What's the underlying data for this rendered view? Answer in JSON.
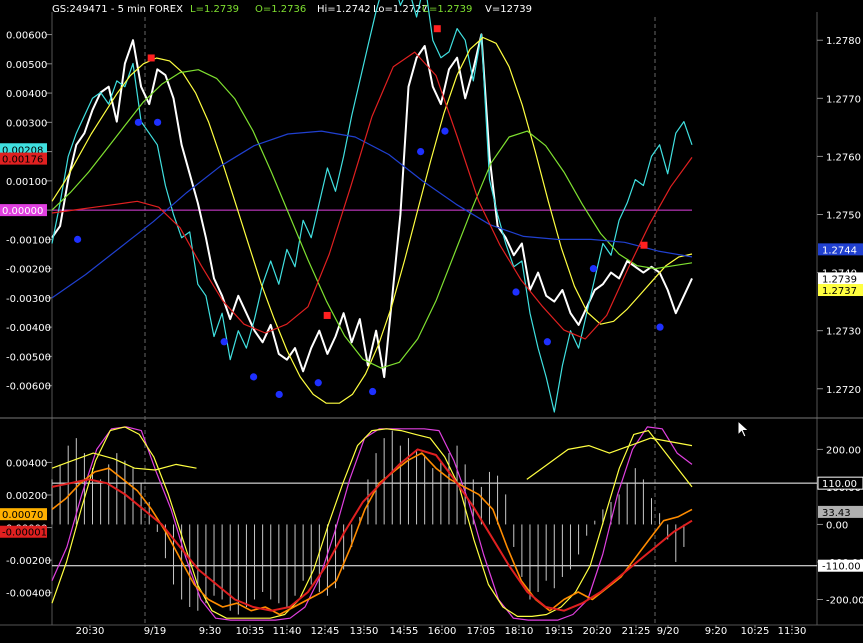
{
  "header": {
    "symbol": "GS:249471 - 5 min  FOREX",
    "last": "L=1.2739",
    "open": "O=1.2736",
    "high": "Hi=1.2742",
    "low": "Lo=1.2727",
    "close": "C=1.2739",
    "volume": "V=12739"
  },
  "colors": {
    "background": "#000000",
    "grid": "#3a3a3a",
    "price": "#ffffff",
    "cyan": "#40e0e0",
    "yellow": "#ffff40",
    "green": "#7fe030",
    "red": "#e02020",
    "blue": "#2040d0",
    "magenta": "#e040e0",
    "orange": "#ff8c00",
    "histogram": "#c8c8c8",
    "accent_dots_blue": "#1e30ff",
    "accent_dots_red": "#ff2020"
  },
  "chart_data": [
    {
      "type": "line",
      "name": "price-panel",
      "left_axis": {
        "ticks": [
          "0.00600",
          "0.00500",
          "0.00400",
          "0.00300",
          "0.00200",
          "0.00100",
          "0.00000",
          "-0.00100",
          "-0.00200",
          "-0.00300",
          "-0.00400",
          "-0.00500",
          "-0.00600"
        ],
        "range": [
          -0.0069,
          0.0066
        ]
      },
      "right_axis": {
        "ticks": [
          "1.2780",
          "1.2770",
          "1.2760",
          "1.2750",
          "1.2740",
          "1.2730",
          "1.2720"
        ],
        "range": [
          1.2716,
          1.2784
        ]
      },
      "left_badges": [
        {
          "text": "0.00208",
          "value": 0.00208,
          "color": "#40e0e0",
          "text_color": "#000000"
        },
        {
          "text": "0.00176",
          "value": 0.00176,
          "color": "#e02020",
          "text_color": "#000000"
        },
        {
          "text": "0.00000",
          "value": 0.0,
          "color": "#e040e0",
          "text_color": "#ffffff"
        }
      ],
      "right_badges": [
        {
          "text": "1.2744",
          "value": 1.2744,
          "color": "#2040d0",
          "text_color": "#ffffff"
        },
        {
          "text": "1.2740",
          "value": 1.274,
          "color": "#000000",
          "text_color": "#ffffff"
        },
        {
          "text": "1.2739",
          "value": 1.2739,
          "color": "#ffffff",
          "text_color": "#000000"
        },
        {
          "text": "1.2737",
          "value": 1.2737,
          "color": "#ffff40",
          "text_color": "#000000"
        }
      ],
      "reference_line": {
        "value": 0.0,
        "color": "#e040e0"
      },
      "series": [
        {
          "id": "price",
          "color": "#ffffff",
          "width": 2,
          "axis": "right",
          "values": [
            1.2746,
            1.2748,
            1.2756,
            1.2762,
            1.2764,
            1.2768,
            1.2771,
            1.2772,
            1.2766,
            1.2776,
            1.278,
            1.2772,
            1.2769,
            1.2775,
            1.2774,
            1.277,
            1.2762,
            1.2757,
            1.2752,
            1.2746,
            1.2739,
            1.2736,
            1.2732,
            1.2736,
            1.2733,
            1.273,
            1.2728,
            1.2731,
            1.2726,
            1.2725,
            1.2727,
            1.2723,
            1.2727,
            1.273,
            1.2726,
            1.2729,
            1.2733,
            1.2728,
            1.2732,
            1.2724,
            1.273,
            1.2722,
            1.2736,
            1.275,
            1.2772,
            1.2777,
            1.2779,
            1.2772,
            1.2769,
            1.2775,
            1.2777,
            1.277,
            1.2775,
            1.2781,
            1.276,
            1.2748,
            1.2746,
            1.2743,
            1.2745,
            1.2737,
            1.274,
            1.2736,
            1.2735,
            1.2737,
            1.2733,
            1.2731,
            1.2734,
            1.2737,
            1.2738,
            1.274,
            1.2739,
            1.2742,
            1.2741,
            1.274,
            1.2741,
            1.274,
            1.2737,
            1.2733,
            1.2736,
            1.2739
          ]
        },
        {
          "id": "cyan-line",
          "color": "#40e0e0",
          "width": 1.2,
          "axis": "right",
          "values": [
            1.2745,
            1.2752,
            1.276,
            1.2764,
            1.2767,
            1.277,
            1.2771,
            1.2769,
            1.2773,
            1.2772,
            1.2776,
            1.2766,
            1.2764,
            1.2762,
            1.2755,
            1.275,
            1.2746,
            1.2747,
            1.2738,
            1.2736,
            1.2729,
            1.2733,
            1.2725,
            1.273,
            1.2727,
            1.2732,
            1.2738,
            1.2742,
            1.2738,
            1.2744,
            1.2741,
            1.2749,
            1.2746,
            1.2752,
            1.2758,
            1.2754,
            1.276,
            1.2767,
            1.2773,
            1.2779,
            1.2785,
            1.279,
            1.2791,
            1.2786,
            1.2789,
            1.2784,
            1.279,
            1.278,
            1.2777,
            1.2778,
            1.2782,
            1.278,
            1.2773,
            1.2781,
            1.2756,
            1.275,
            1.2745,
            1.2741,
            1.2742,
            1.2733,
            1.2727,
            1.2722,
            1.2716,
            1.2724,
            1.273,
            1.2727,
            1.2733,
            1.2739,
            1.2745,
            1.2743,
            1.2749,
            1.2752,
            1.2756,
            1.2755,
            1.276,
            1.2762,
            1.2757,
            1.2764,
            1.2766,
            1.2762
          ]
        },
        {
          "id": "yellow-line",
          "color": "#ffff40",
          "width": 1.2,
          "axis": "left",
          "values": [
            0.0003,
            0.001,
            0.0018,
            0.0026,
            0.0033,
            0.004,
            0.0046,
            0.005,
            0.0052,
            0.0051,
            0.0047,
            0.004,
            0.003,
            0.0017,
            0.0003,
            -0.0011,
            -0.0025,
            -0.0037,
            -0.0048,
            -0.0057,
            -0.0063,
            -0.0066,
            -0.0066,
            -0.0063,
            -0.0056,
            -0.0046,
            -0.0033,
            -0.0017,
            0.0,
            0.0017,
            0.0033,
            0.0046,
            0.0055,
            0.0059,
            0.0057,
            0.0049,
            0.0036,
            0.002,
            0.0003,
            -0.0013,
            -0.0026,
            -0.0035,
            -0.0039,
            -0.0038,
            -0.0034,
            -0.0029,
            -0.0024,
            -0.0019,
            -0.0016,
            -0.0015
          ]
        },
        {
          "id": "green-line",
          "color": "#7fe030",
          "width": 1.2,
          "axis": "left",
          "values": [
            0.0,
            0.0006,
            0.0013,
            0.0021,
            0.0029,
            0.0037,
            0.0043,
            0.0047,
            0.0048,
            0.0045,
            0.0038,
            0.0027,
            0.0013,
            -0.0002,
            -0.0017,
            -0.0031,
            -0.0043,
            -0.0051,
            -0.0054,
            -0.0052,
            -0.0044,
            -0.0031,
            -0.0015,
            0.0001,
            0.0016,
            0.0025,
            0.0027,
            0.0022,
            0.0013,
            0.0002,
            -0.0008,
            -0.0015,
            -0.0019,
            -0.002,
            -0.0019,
            -0.0018
          ]
        },
        {
          "id": "blue-line",
          "color": "#2040d0",
          "width": 1.2,
          "axis": "left",
          "values": [
            -0.003,
            -0.0022,
            -0.0013,
            -0.0004,
            0.0006,
            0.0015,
            0.0022,
            0.0026,
            0.0027,
            0.0025,
            0.0019,
            0.001,
            0.0002,
            -0.0005,
            -0.0009,
            -0.001,
            -0.001,
            -0.0011,
            -0.0014,
            -0.0016
          ]
        },
        {
          "id": "red-line",
          "color": "#e02020",
          "width": 1.2,
          "axis": "left",
          "values": [
            -0.0001,
            0.0,
            0.0001,
            0.0002,
            0.0003,
            0.0001,
            -0.0006,
            -0.0019,
            -0.0031,
            -0.0039,
            -0.0042,
            -0.0039,
            -0.0033,
            -0.0015,
            0.0008,
            0.0032,
            0.0049,
            0.0054,
            0.0046,
            0.0025,
            0.0003,
            -0.0012,
            -0.0024,
            -0.0033,
            -0.0041,
            -0.0044,
            -0.0036,
            -0.002,
            -0.0005,
            0.0008,
            0.0018
          ]
        }
      ],
      "dots": [
        {
          "x": 0.04,
          "value": -0.001,
          "color": "#1e30ff"
        },
        {
          "x": 0.135,
          "value": 0.003,
          "color": "#1e30ff"
        },
        {
          "x": 0.165,
          "value": 0.003,
          "color": "#1e30ff"
        },
        {
          "x": 0.155,
          "value": 0.0052,
          "color": "#ff2020"
        },
        {
          "x": 0.269,
          "value": -0.0045,
          "color": "#1e30ff"
        },
        {
          "x": 0.315,
          "value": -0.0057,
          "color": "#1e30ff"
        },
        {
          "x": 0.355,
          "value": -0.0063,
          "color": "#1e30ff"
        },
        {
          "x": 0.416,
          "value": -0.0059,
          "color": "#1e30ff"
        },
        {
          "x": 0.43,
          "value": -0.0036,
          "color": "#ff2020"
        },
        {
          "x": 0.501,
          "value": -0.0062,
          "color": "#1e30ff"
        },
        {
          "x": 0.576,
          "value": 0.002,
          "color": "#1e30ff"
        },
        {
          "x": 0.614,
          "value": 0.0027,
          "color": "#1e30ff"
        },
        {
          "x": 0.602,
          "value": 0.0062,
          "color": "#ff2020"
        },
        {
          "x": 0.725,
          "value": -0.0028,
          "color": "#1e30ff"
        },
        {
          "x": 0.774,
          "value": -0.0045,
          "color": "#1e30ff"
        },
        {
          "x": 0.846,
          "value": -0.002,
          "color": "#1e30ff"
        },
        {
          "x": 0.925,
          "value": -0.0012,
          "color": "#ff2020"
        },
        {
          "x": 0.95,
          "value": -0.004,
          "color": "#1e30ff"
        }
      ]
    },
    {
      "type": "line",
      "name": "oscillator-panel",
      "left_axis": {
        "ticks": [
          "0.00400",
          "0.00200",
          "0.00000",
          "-0.00200",
          "-0.00400"
        ],
        "range": [
          -0.0058,
          0.0063
        ]
      },
      "right_axis": {
        "ticks": [
          "200.00",
          "100.00",
          "0.00",
          "-100.00",
          "-200.00"
        ],
        "range": [
          -260,
          265
        ]
      },
      "hlines": [
        110,
        -110
      ],
      "left_badges": [
        {
          "text": "0.00070",
          "value": 0.0007,
          "color": "#ffb000",
          "text_color": "#000000"
        },
        {
          "text": "-0.00001",
          "value": -1e-05,
          "color": "#e02020",
          "text_color": "#000000"
        }
      ],
      "right_badges": [
        {
          "text": "110.00",
          "value": 110,
          "color": "#000000",
          "text_color": "#ffffff",
          "border": "#ffffff"
        },
        {
          "text": "33.43",
          "value": 33.43,
          "color": "#b0b0b0",
          "text_color": "#000000"
        },
        {
          "text": "-110.00",
          "value": -110,
          "color": "#ffffff",
          "text_color": "#000000"
        }
      ],
      "series": [
        {
          "id": "hist",
          "color": "#c8c8c8",
          "kind": "histogram",
          "values": [
            120,
            160,
            210,
            230,
            190,
            150,
            120,
            160,
            190,
            170,
            150,
            110,
            60,
            -20,
            -90,
            -160,
            -200,
            -220,
            -230,
            -210,
            -190,
            -200,
            -230,
            -240,
            -220,
            -200,
            -180,
            -200,
            -210,
            -220,
            -190,
            -150,
            -160,
            -180,
            -190,
            -170,
            -120,
            -60,
            20,
            120,
            190,
            230,
            250,
            210,
            230,
            200,
            180,
            150,
            170,
            190,
            210,
            160,
            120,
            100,
            140,
            130,
            80,
            -60,
            -140,
            -200,
            -180,
            -150,
            -170,
            -140,
            -120,
            -80,
            -30,
            10,
            40,
            60,
            80,
            110,
            150,
            120,
            70,
            30,
            -40,
            -100,
            -60,
            0
          ]
        },
        {
          "id": "magenta-osc",
          "color": "#e040e0",
          "width": 1.2,
          "axis": "right",
          "values": [
            -150,
            -60,
            80,
            200,
            255,
            260,
            250,
            140,
            40,
            -90,
            -200,
            -250,
            -255,
            -255,
            -255,
            -255,
            -250,
            -220,
            -140,
            -20,
            120,
            230,
            255,
            255,
            255,
            255,
            250,
            170,
            60,
            -80,
            -200,
            -250,
            -255,
            -255,
            -255,
            -240,
            -200,
            -80,
            80,
            200,
            260,
            255,
            190,
            160
          ]
        },
        {
          "id": "yellow-osc",
          "color": "#ffff40",
          "width": 1.2,
          "axis": "right",
          "values": [
            -210,
            -100,
            40,
            170,
            250,
            260,
            240,
            180,
            80,
            -40,
            -160,
            -230,
            -250,
            -250,
            -250,
            -250,
            -240,
            -200,
            -120,
            0,
            110,
            210,
            250,
            255,
            250,
            240,
            230,
            180,
            100,
            -40,
            -160,
            -220,
            -245,
            -245,
            -240,
            -220,
            -180,
            -110,
            20,
            150,
            240,
            250,
            200,
            150,
            100
          ]
        },
        {
          "id": "orange-osc",
          "color": "#ff8c00",
          "width": 1.6,
          "axis": "right",
          "values": [
            40,
            70,
            110,
            140,
            150,
            120,
            90,
            40,
            -20,
            -90,
            -160,
            -200,
            -220,
            -210,
            -230,
            -220,
            -240,
            -220,
            -200,
            -180,
            -150,
            -60,
            40,
            110,
            140,
            170,
            190,
            150,
            120,
            100,
            80,
            40,
            -60,
            -150,
            -200,
            -230,
            -200,
            -180,
            -200,
            -170,
            -140,
            -90,
            -40,
            10,
            20,
            40
          ]
        },
        {
          "id": "yellow-jag",
          "color": "#ffff40",
          "width": 1.2,
          "axis": "right",
          "values": [
            150,
            170,
            190,
            175,
            150,
            145,
            160,
            150,
            null,
            null,
            null,
            null,
            null,
            null,
            null,
            null,
            null,
            null,
            null,
            null,
            null,
            null,
            null,
            120,
            160,
            200,
            210,
            190,
            210,
            230,
            220,
            210
          ]
        },
        {
          "id": "red-osc",
          "color": "#e02020",
          "width": 2,
          "axis": "right",
          "values": [
            100,
            110,
            120,
            110,
            80,
            40,
            0,
            -60,
            -120,
            -160,
            -200,
            -220,
            -230,
            -220,
            -180,
            -110,
            -20,
            60,
            110,
            160,
            200,
            185,
            120,
            50,
            -30,
            -110,
            -180,
            -220,
            -230,
            -210,
            -180,
            -140,
            -100,
            -60,
            -20,
            10
          ]
        }
      ]
    }
  ],
  "x_axis": {
    "labels": [
      "20:30",
      "9/19",
      "9:30",
      "10:35",
      "11:40",
      "12:45",
      "13:50",
      "14:55",
      "16:00",
      "17:05",
      "18:10",
      "19:15",
      "20:20",
      "21:25",
      "9/20",
      "9:20",
      "10:25",
      "11:30"
    ]
  }
}
